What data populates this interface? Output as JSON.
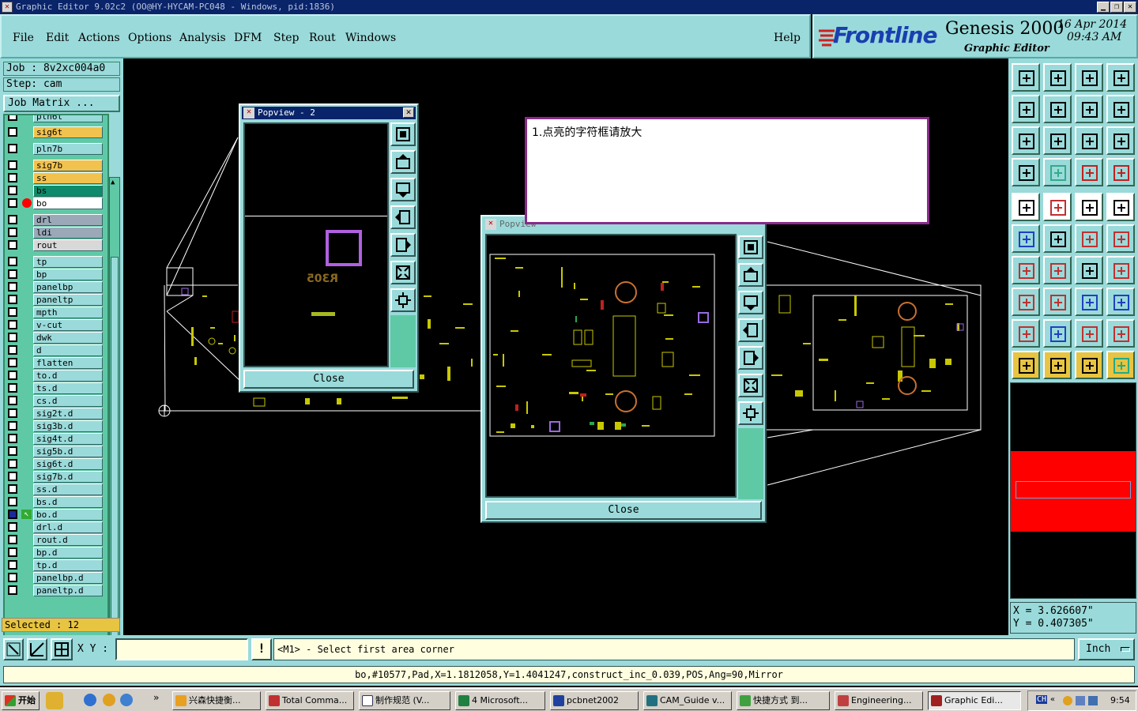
{
  "window": {
    "title": "Graphic Editor 9.02c2  (OO@HY-HYCAM-PC048 - Windows, pid:1836)",
    "controls": [
      "▁",
      "❐",
      "✕"
    ]
  },
  "menu": {
    "items": [
      "File",
      "Edit",
      "Actions",
      "Options",
      "Analysis",
      "DFM",
      "Step",
      "Rout",
      "Windows"
    ],
    "help": "Help"
  },
  "brand": {
    "logo": "Frontline",
    "product": "Genesis 2000",
    "subtitle": "Graphic Editor",
    "date": "16 Apr 2014",
    "time": "09:43 AM"
  },
  "left_panel": {
    "job": "Job : 8v2xc004a0",
    "step": "Step: cam",
    "job_matrix": "Job Matrix ...",
    "layers": [
      {
        "name": "pln6t",
        "color": "#9adada"
      },
      {
        "name": "sig6t",
        "color": "#f2c24e"
      },
      {
        "name": "pln7b",
        "color": "#9adada"
      },
      {
        "name": "sig7b",
        "color": "#f2c24e"
      },
      {
        "name": "ss",
        "color": "#f2c24e"
      },
      {
        "name": "bs",
        "color": "#0f8a6a"
      },
      {
        "name": "bo",
        "color": "#ffffff",
        "marker": "red-dot"
      },
      {
        "name": "drl",
        "color": "#9aa8b8"
      },
      {
        "name": "ldi",
        "color": "#9aa8b8"
      },
      {
        "name": "rout",
        "color": "#d8d8d8"
      },
      {
        "name": "tp",
        "color": "#9adada"
      },
      {
        "name": "bp",
        "color": "#9adada"
      },
      {
        "name": "panelbp",
        "color": "#9adada"
      },
      {
        "name": "paneltp",
        "color": "#9adada"
      },
      {
        "name": "mpth",
        "color": "#9adada"
      },
      {
        "name": "v-cut",
        "color": "#9adada"
      },
      {
        "name": "dwk",
        "color": "#9adada"
      },
      {
        "name": "d",
        "color": "#9adada"
      },
      {
        "name": "flatten",
        "color": "#9adada"
      },
      {
        "name": "to.d",
        "color": "#9adada"
      },
      {
        "name": "ts.d",
        "color": "#9adada"
      },
      {
        "name": "cs.d",
        "color": "#9adada"
      },
      {
        "name": "sig2t.d",
        "color": "#9adada"
      },
      {
        "name": "sig3b.d",
        "color": "#9adada"
      },
      {
        "name": "sig4t.d",
        "color": "#9adada"
      },
      {
        "name": "sig5b.d",
        "color": "#9adada"
      },
      {
        "name": "sig6t.d",
        "color": "#9adada"
      },
      {
        "name": "sig7b.d",
        "color": "#9adada"
      },
      {
        "name": "ss.d",
        "color": "#9adada"
      },
      {
        "name": "bs.d",
        "color": "#9adada"
      },
      {
        "name": "bo.d",
        "color": "#9adada",
        "marker": "arrow"
      },
      {
        "name": "drl.d",
        "color": "#9adada"
      },
      {
        "name": "rout.d",
        "color": "#9adada"
      },
      {
        "name": "bp.d",
        "color": "#9adada"
      },
      {
        "name": "tp.d",
        "color": "#9adada"
      },
      {
        "name": "panelbp.d",
        "color": "#9adada"
      },
      {
        "name": "paneltp.d",
        "color": "#9adada"
      }
    ],
    "selected": "Selected : 12"
  },
  "popview2": {
    "title": "Popview - 2",
    "label": "R305",
    "close": "Close"
  },
  "popview3": {
    "title": "Popview",
    "close": "Close"
  },
  "note": {
    "text": "1.点亮的字符框请放大"
  },
  "coords": {
    "x": "X = 3.626607\"",
    "y": "Y = 0.407305\""
  },
  "bottom": {
    "xy_label": "X Y :",
    "xy_value": "",
    "message": "<M1> - Select first area corner",
    "units": "Inch"
  },
  "status": "bo,#10577,Pad,X=1.1812058,Y=1.4041247,construct_inc_0.039,POS,Ang=90,Mirror",
  "taskbar": {
    "start": "开始",
    "tasks": [
      "兴森快捷衡...",
      "Total Comma...",
      "制作规范 (V...",
      "4 Microsoft...",
      "pcbnet2002",
      "CAM_Guide v...",
      "快捷方式 到...",
      "Engineering...",
      "Graphic Edi..."
    ],
    "tray_label": "CH",
    "clock": "9:54"
  },
  "colors": {
    "panel": "#9adada",
    "layer_list": "#5fc9a6",
    "title_bar": "#0a246a",
    "board_yellow": "#c8c800",
    "outline_white": "#ffffff",
    "highlight_purple": "#b060e0",
    "overview_red": "#ff0000"
  }
}
